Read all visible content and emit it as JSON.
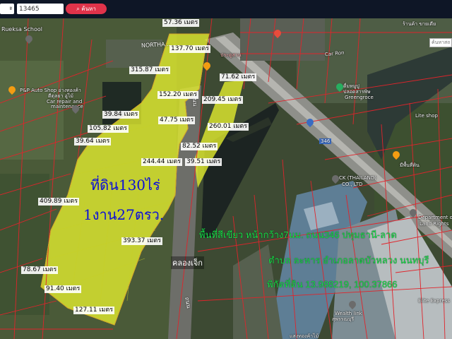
{
  "toolbar": {
    "select_value": "ะ",
    "search_value": "13465",
    "search_button": "ค้นหา"
  },
  "map": {
    "side_search_placeholder": "ค้นหาสถาน",
    "road_labels": {
      "top_left": "NORTHA...",
      "top_road": "PATHUMTHANI",
      "road_soi": "ถนน",
      "road_code": "346",
      "bottom_road": "ถนน"
    },
    "measurements": [
      {
        "id": "m1",
        "text": "57.36 เมตร"
      },
      {
        "id": "m2",
        "text": "137.70 เมตร"
      },
      {
        "id": "m3",
        "text": "315.87 เมตร"
      },
      {
        "id": "m4",
        "text": "71.62 เมตร"
      },
      {
        "id": "m5",
        "text": "152.20 เมตร"
      },
      {
        "id": "m6",
        "text": "209.45 เมตร"
      },
      {
        "id": "m7",
        "text": "39.84 เมตร"
      },
      {
        "id": "m8",
        "text": "47.75 เมตร"
      },
      {
        "id": "m9",
        "text": "260.01 เมตร"
      },
      {
        "id": "m10",
        "text": "105.82 เมตร"
      },
      {
        "id": "m11",
        "text": "39.64 เมตร"
      },
      {
        "id": "m12",
        "text": "82.52 เมตร"
      },
      {
        "id": "m13",
        "text": "244.44 เมตร"
      },
      {
        "id": "m14",
        "text": "39.51 เมตร"
      },
      {
        "id": "m15",
        "text": "409.89 เมตร"
      },
      {
        "id": "m16",
        "text": "393.37 เมตร"
      },
      {
        "id": "m17",
        "text": "78.67 เมตร"
      },
      {
        "id": "m18",
        "text": "91.40 เมตร"
      },
      {
        "id": "m19",
        "text": "127.11 เมตร"
      }
    ],
    "land_title_line1": "ที่ดิน130ไร่",
    "land_title_line2": "1งาน27ตรว.",
    "canal_label": "คลองเจ็ก",
    "info_line1": "พื้นที่สีเขียว หน้ากว้าง7นม. ถนน346 ปทุมธานี-ลาด",
    "info_line2": "ตำบล ละหาร อำเภอลาดบัวหลวง นนทบุรี",
    "info_line3": "พิกัดที่ดิน 13.988219, 100.37866",
    "pois": [
      {
        "id": "p1",
        "text": "Rueksa School"
      },
      {
        "id": "p2",
        "text": "P&P Auto Shop อ่างทองค้า"
      },
      {
        "id": "p3",
        "text": "ตีตุลยา อู่ไม้"
      },
      {
        "id": "p4",
        "text": "Car repair and"
      },
      {
        "id": "p5",
        "text": "maintenance"
      },
      {
        "id": "p6",
        "text": "ร้านค้า ขายเตีย"
      },
      {
        "id": "p7",
        "text": "ประตูสวน"
      },
      {
        "id": "p8",
        "text": "ดื่มหมูปู"
      },
      {
        "id": "p9",
        "text": "ปลอดสารพิษ"
      },
      {
        "id": "p10",
        "text": "Greengroce"
      },
      {
        "id": "p11",
        "text": "CK (THAILAND)"
      },
      {
        "id": "p12",
        "text": "CO., LTD"
      },
      {
        "id": "p13",
        "text": "Department of"
      },
      {
        "id": "p14",
        "text": "Land Rights"
      },
      {
        "id": "p15",
        "text": "Wealth link"
      },
      {
        "id": "p16",
        "text": "สุพรรณบุรี"
      },
      {
        "id": "p17",
        "text": "Elite Express"
      },
      {
        "id": "p18",
        "text": "แสงทองค้าไม้"
      },
      {
        "id": "p19",
        "text": "มีพื้นที่ดิน"
      },
      {
        "id": "p20",
        "text": "Car Ron"
      },
      {
        "id": "p21",
        "text": "Lite shop"
      }
    ]
  },
  "colors": {
    "topbar": "#0e1626",
    "search_button": "#e0334a",
    "land_fill": "#e6ef2e",
    "parcel_lines": "#e0242b",
    "big_text": "#0b0fd8",
    "info_text": "#19e04a"
  }
}
